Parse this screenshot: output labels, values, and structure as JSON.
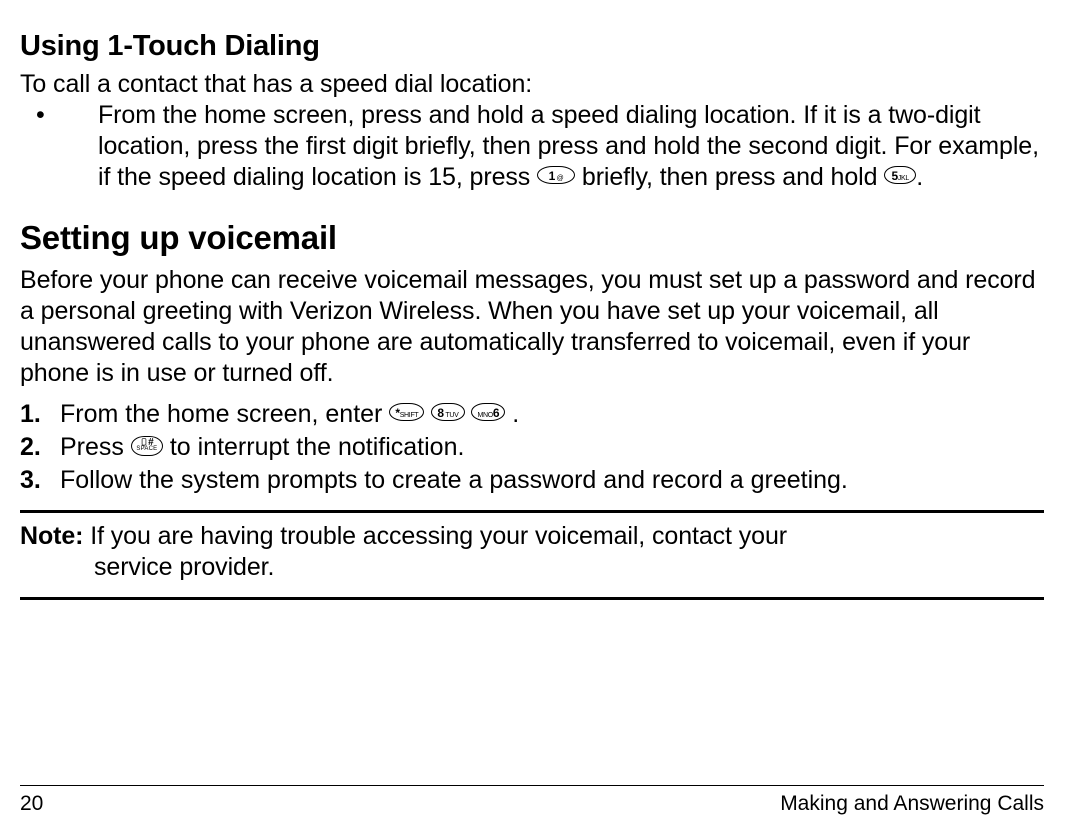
{
  "sectionA": {
    "heading": "Using 1-Touch Dialing",
    "intro": "To call a contact that has a speed dial location:",
    "bullet_part1": "From the home screen, press and hold a speed dialing location. If it is a two-digit location, press the first digit briefly, then press and hold the second digit. For example, if the speed dialing location is 15, press ",
    "key1_big": "1",
    "key1_sm": "@",
    "bullet_part2": " briefly, then press and hold ",
    "key2_big": "5",
    "key2_sm": "JKL",
    "bullet_part3": "."
  },
  "sectionB": {
    "heading": "Setting up voicemail",
    "para": "Before your phone can receive voicemail messages, you must set up a password and record a personal greeting with Verizon Wireless. When you have set up your voicemail, all unanswered calls to your phone are automatically transferred to voicemail, even if your phone is in use or turned off.",
    "steps": [
      {
        "num": "1.",
        "before": "From the home screen, enter ",
        "keys": [
          {
            "big": "*",
            "sm": "SHIFT"
          },
          {
            "big": "8",
            "sm": "TUV"
          },
          {
            "sm_left": "MNO",
            "big": "6"
          }
        ],
        "after": " ."
      },
      {
        "num": "2.",
        "before": "Press ",
        "space_key": true,
        "after": " to interrupt the notification."
      },
      {
        "num": "3.",
        "text": "Follow the system prompts to create a password and record a greeting."
      }
    ],
    "note_label": "Note:",
    "note_rest_line1": " If you are having trouble accessing your voicemail, contact your",
    "note_line2": "service provider."
  },
  "footer": {
    "page": "20",
    "chapter": "Making and Answering Calls"
  }
}
